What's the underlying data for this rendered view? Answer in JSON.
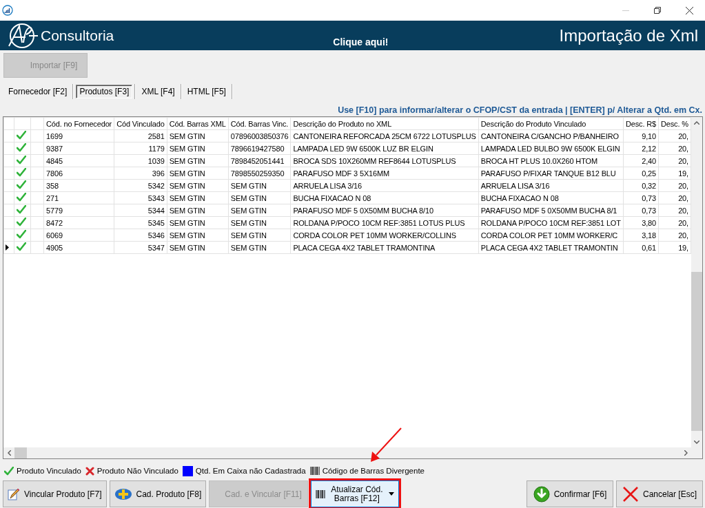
{
  "header": {
    "brand": "Consultoria",
    "link": "Clique aqui!",
    "title": "Importação de Xml"
  },
  "toolbar": {
    "import_button": {
      "label": "Importar [F9]",
      "disabled": true
    }
  },
  "tabs": [
    {
      "label": "Fornecedor [F2]",
      "selected": false
    },
    {
      "label": "Produtos [F3]",
      "selected": true
    },
    {
      "label": "XML [F4]",
      "selected": false
    },
    {
      "label": "HTML [F5]",
      "selected": false
    }
  ],
  "hint": "Use [F10] para informar/alterar o CFOP/CST da entrada | [ENTER] p/ Alterar a Qtd. em Cx.",
  "table": {
    "columns": [
      "Cód. no Fornecedor",
      "Cód Vinculado",
      "Cód. Barras XML",
      "Cód. Barras Vinc.",
      "Descrição do Produto no XML",
      "Descrição do Produto Vinculado",
      "Desc. R$",
      "Desc. %"
    ],
    "rows": [
      {
        "kind": "linked",
        "selected": false,
        "cells": [
          "1699",
          "2581",
          "SEM GTIN",
          "07896003850376",
          "CANTONEIRA REFORCADA 25CM 6722 LOTUSPLUS",
          "CANTONEIRA C/GANCHO P/BANHEIRO",
          "9,10",
          "20,"
        ]
      },
      {
        "kind": "linked",
        "selected": false,
        "cells": [
          "9387",
          "1179",
          "SEM GTIN",
          "7896619427580",
          "LAMPADA LED 9W 6500K LUZ BR ELGIN",
          "LAMPADA LED BULBO 9W 6500K ELGIN",
          "2,12",
          "20,"
        ]
      },
      {
        "kind": "linked",
        "selected": false,
        "cells": [
          "4845",
          "1039",
          "SEM GTIN",
          "7898452051441",
          "BROCA SDS 10X260MM REF8644 LOTUSPLUS",
          "BROCA HT PLUS 10.0X260 HTOM",
          "2,40",
          "20,"
        ]
      },
      {
        "kind": "linked",
        "selected": false,
        "cells": [
          "7806",
          "396",
          "SEM GTIN",
          "7898550259350",
          "PARAFUSO MDF 3 5X16MM",
          "PARAFUSO P/FIXAR TANQUE B12  BLU",
          "0,25",
          "19,"
        ]
      },
      {
        "kind": "linked",
        "selected": false,
        "cells": [
          "358",
          "5342",
          "SEM GTIN",
          "SEM GTIN",
          "ARRUELA LISA 3/16",
          "ARRUELA LISA 3/16",
          "0,32",
          "20,"
        ]
      },
      {
        "kind": "linked",
        "selected": false,
        "cells": [
          "271",
          "5343",
          "SEM GTIN",
          "SEM GTIN",
          "BUCHA FIXACAO N 08",
          "BUCHA FIXACAO N 08",
          "0,73",
          "20,"
        ]
      },
      {
        "kind": "linked",
        "selected": false,
        "cells": [
          "5779",
          "5344",
          "SEM GTIN",
          "SEM GTIN",
          "PARAFUSO MDF 5 0X50MM BUCHA 8/10",
          "PARAFUSO MDF 5 0X50MM BUCHA 8/1",
          "0,73",
          "20,"
        ]
      },
      {
        "kind": "linked",
        "selected": false,
        "cells": [
          "8472",
          "5345",
          "SEM GTIN",
          "SEM GTIN",
          "ROLDANA P/POCO 10CM REF:3851 LOTUS PLUS",
          "ROLDANA P/POCO 10CM REF:3851 LOT",
          "3,80",
          "20,"
        ]
      },
      {
        "kind": "linked",
        "selected": false,
        "cells": [
          "6069",
          "5346",
          "SEM GTIN",
          "SEM GTIN",
          "CORDA COLOR PET 10MM WORKER/COLLINS",
          "CORDA COLOR PET 10MM WORKER/C",
          "3,18",
          "20,"
        ]
      },
      {
        "kind": "linked",
        "selected": true,
        "cells": [
          "4905",
          "5347",
          "SEM GTIN",
          "SEM GTIN",
          "PLACA CEGA 4X2 TABLET TRAMONTINA",
          "PLACA CEGA 4X2 TABLET TRAMONTIN",
          "0,61",
          "19,"
        ]
      }
    ]
  },
  "legend": [
    {
      "kind": "check",
      "label": "Produto Vinculado"
    },
    {
      "kind": "cross",
      "label": "Produto Não Vinculado"
    },
    {
      "kind": "square",
      "label": "Qtd. Em Caixa não Cadastrada"
    },
    {
      "kind": "barcode",
      "label": "Código de Barras Divergente"
    }
  ],
  "buttons_left": [
    {
      "kind": "pencil",
      "label": "Vincular Produto [F7]",
      "disabled": false,
      "annotated": false
    },
    {
      "kind": "plus",
      "label": "Cad. Produto [F8]",
      "disabled": false,
      "annotated": false
    },
    {
      "kind": "plain",
      "label": "Cad. e Vincular [F11]",
      "disabled": true,
      "annotated": false
    },
    {
      "kind": "barcode-menu",
      "label": "Atualizar Cód. Barras [F12]",
      "disabled": false,
      "annotated": true
    }
  ],
  "buttons_right": [
    {
      "kind": "confirm",
      "label": "Confirmar [F6]",
      "disabled": false
    },
    {
      "kind": "cancel",
      "label": "Cancelar [Esc]",
      "disabled": false
    }
  ]
}
